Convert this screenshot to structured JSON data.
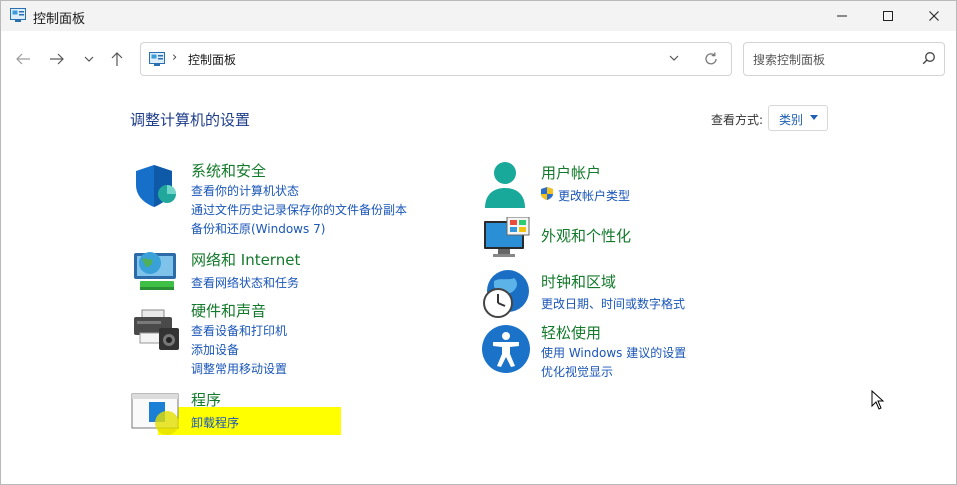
{
  "window": {
    "title": "控制面板"
  },
  "address": {
    "crumb": "控制面板"
  },
  "search": {
    "placeholder": "搜索控制面板"
  },
  "heading": "调整计算机的设置",
  "view": {
    "label": "查看方式:",
    "value": "类别"
  },
  "categories": {
    "security": {
      "title": "系统和安全",
      "links": [
        "查看你的计算机状态",
        "通过文件历史记录保存你的文件备份副本",
        "备份和还原(Windows 7)"
      ]
    },
    "network": {
      "title": "网络和 Internet",
      "links": [
        "查看网络状态和任务"
      ]
    },
    "hardware": {
      "title": "硬件和声音",
      "links": [
        "查看设备和打印机",
        "添加设备",
        "调整常用移动设置"
      ]
    },
    "programs": {
      "title": "程序",
      "links": [
        "卸载程序"
      ]
    },
    "accounts": {
      "title": "用户帐户",
      "links": [
        "更改帐户类型"
      ]
    },
    "appearance": {
      "title": "外观和个性化",
      "links": []
    },
    "clock": {
      "title": "时钟和区域",
      "links": [
        "更改日期、时间或数字格式"
      ]
    },
    "ease": {
      "title": "轻松使用",
      "links": [
        "使用 Windows 建议的设置",
        "优化视觉显示"
      ]
    }
  },
  "colors": {
    "title_green": "#137a2b",
    "link_blue": "#1a56b8",
    "heading_blue": "#1e3d8a",
    "highlight": "#ffff00"
  }
}
